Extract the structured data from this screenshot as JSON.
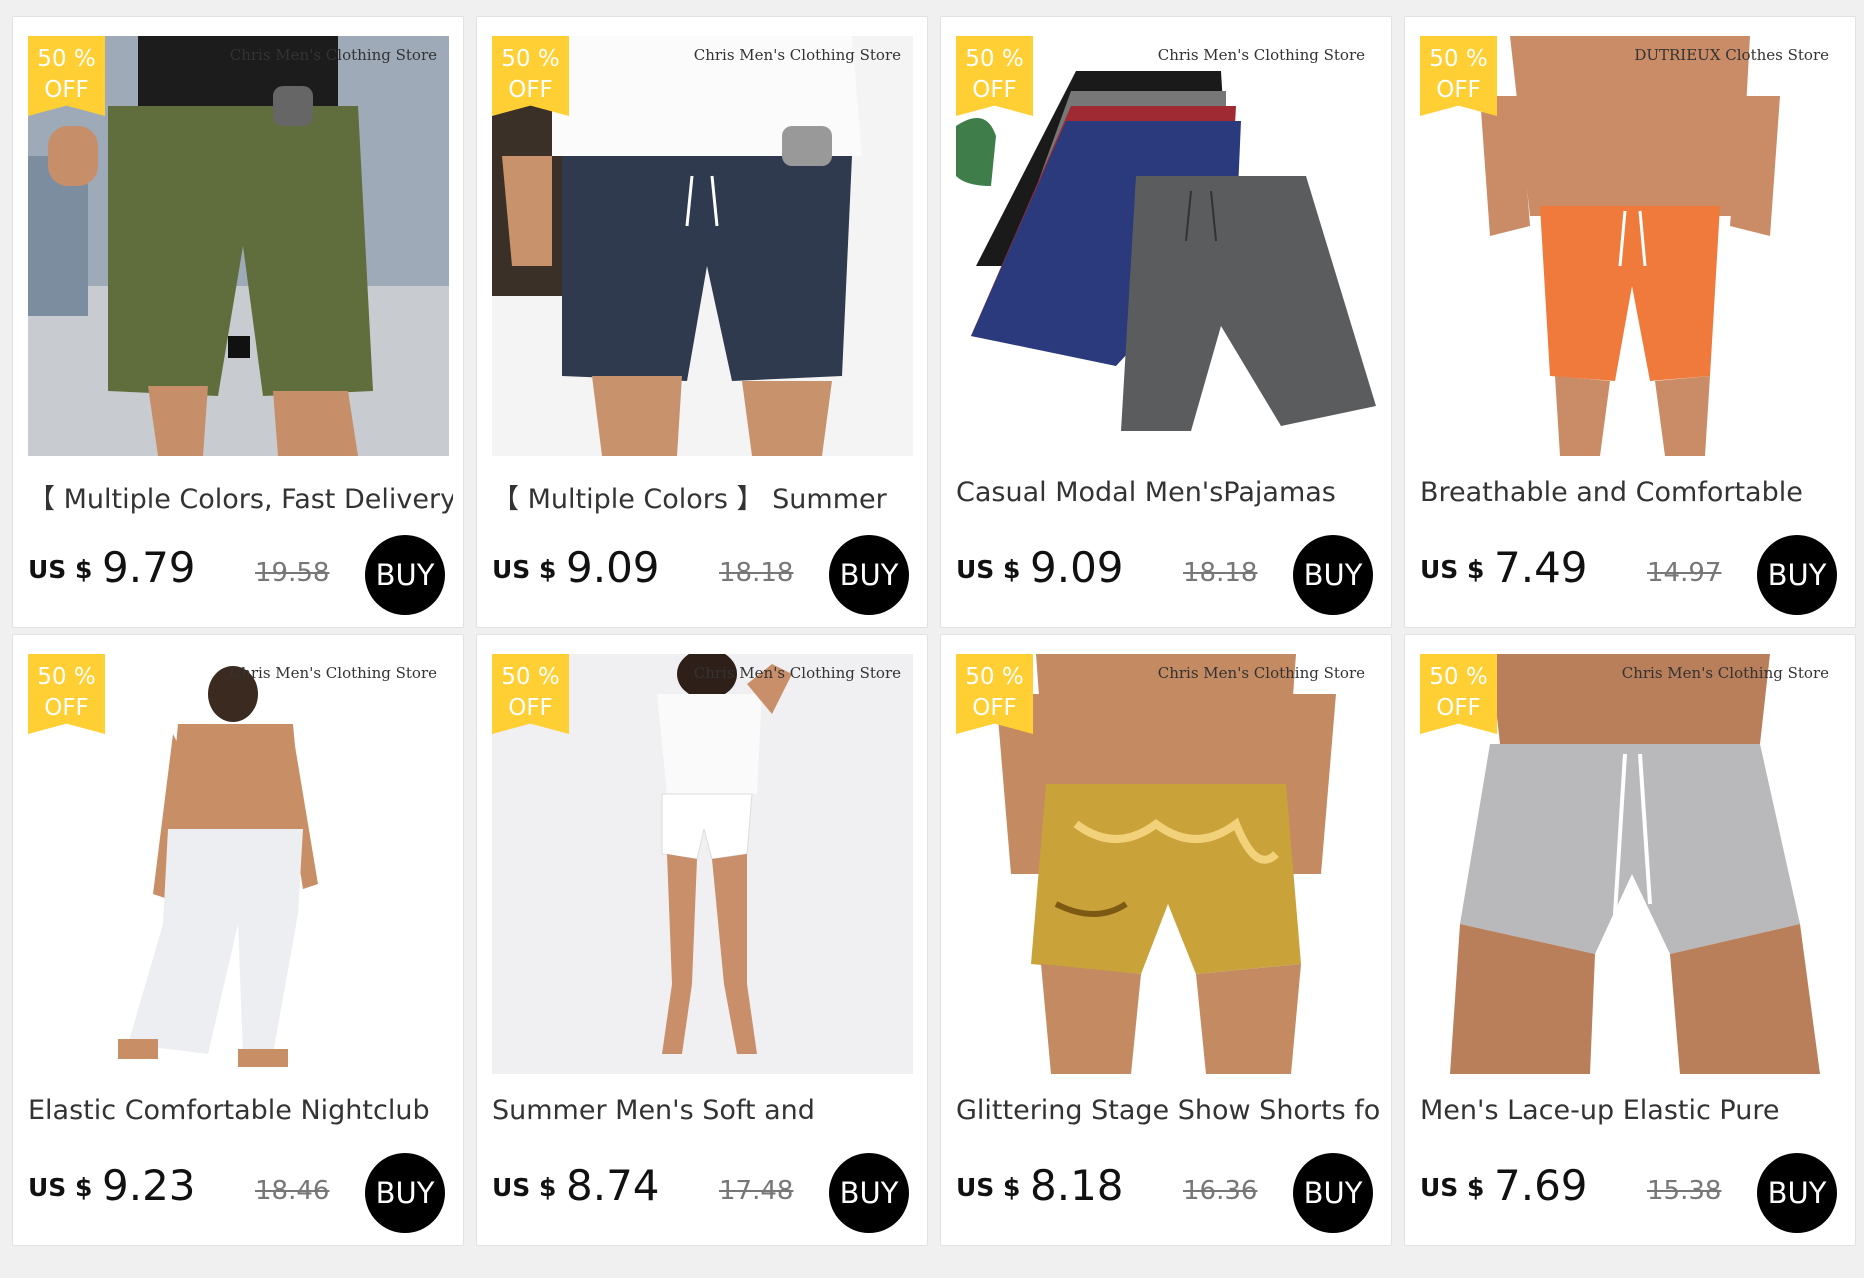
{
  "products": [
    {
      "badge_line1": "50 %",
      "badge_line2": "OFF",
      "store": "Chris Men's Clothing Store",
      "title": "【 Multiple Colors, Fast Delivery",
      "currency": "US $",
      "price": "9.79",
      "original_price": "19.58",
      "buy_label": "BUY",
      "image": "olive-shorts-photo"
    },
    {
      "badge_line1": "50 %",
      "badge_line2": "OFF",
      "store": "Chris Men's Clothing Store",
      "title": "【 Multiple Colors 】 Summer",
      "currency": "US $",
      "price": "9.09",
      "original_price": "18.18",
      "buy_label": "BUY",
      "image": "navy-shorts-photo"
    },
    {
      "badge_line1": "50 %",
      "badge_line2": "OFF",
      "store": "Chris Men's Clothing Store",
      "title": "Casual Modal Men'sPajamas",
      "currency": "US $",
      "price": "9.09",
      "original_price": "18.18",
      "buy_label": "BUY",
      "image": "stacked-pajama-shorts-photo"
    },
    {
      "badge_line1": "50 %",
      "badge_line2": "OFF",
      "store": "DUTRIEUX Clothes Store",
      "title": "Breathable and Comfortable",
      "currency": "US $",
      "price": "7.49",
      "original_price": "14.97",
      "buy_label": "BUY",
      "image": "orange-mesh-shorts-photo"
    },
    {
      "badge_line1": "50 %",
      "badge_line2": "OFF",
      "store": "Chris Men's Clothing Store",
      "title": "Elastic Comfortable Nightclub",
      "currency": "US $",
      "price": "9.23",
      "original_price": "18.46",
      "buy_label": "BUY",
      "image": "white-leggings-photo"
    },
    {
      "badge_line1": "50 %",
      "badge_line2": "OFF",
      "store": "Chris Men's Clothing Store",
      "title": "Summer Men's Soft and",
      "currency": "US $",
      "price": "8.74",
      "original_price": "17.48",
      "buy_label": "BUY",
      "image": "white-shorts-photo"
    },
    {
      "badge_line1": "50 %",
      "badge_line2": "OFF",
      "store": "Chris Men's Clothing Store",
      "title": "Glittering Stage Show Shorts for",
      "currency": "US $",
      "price": "8.18",
      "original_price": "16.36",
      "buy_label": "BUY",
      "image": "gold-shorts-photo"
    },
    {
      "badge_line1": "50 %",
      "badge_line2": "OFF",
      "store": "Chris Men's Clothing Store",
      "title": "Men's Lace-up Elastic Pure",
      "currency": "US $",
      "price": "7.69",
      "original_price": "15.38",
      "buy_label": "BUY",
      "image": "gray-shorts-photo"
    }
  ],
  "colors": {
    "badge": "#ffcf33",
    "buy_button": "#000000",
    "page_background": "#f0f0f0"
  }
}
